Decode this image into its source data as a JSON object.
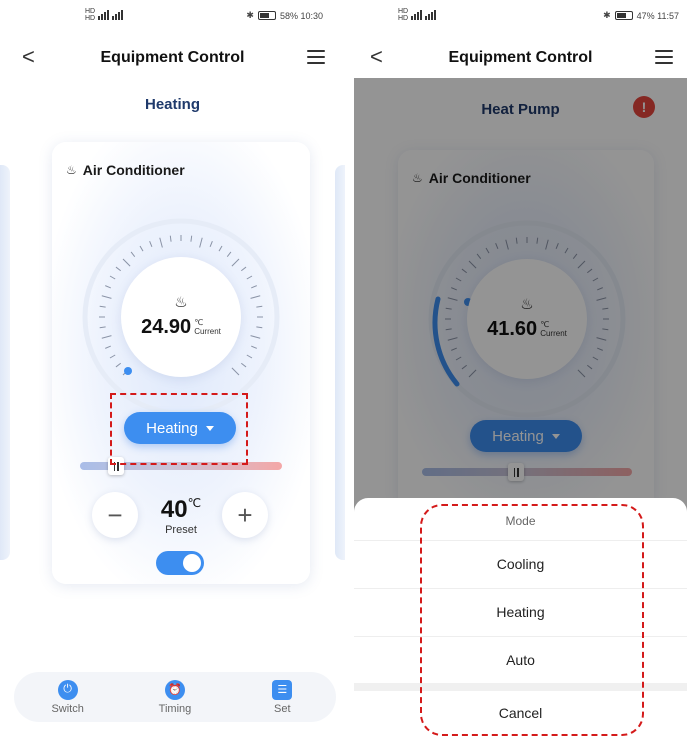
{
  "left": {
    "status": {
      "network": "HD 4G 4G",
      "right_text": "58% 10:30"
    },
    "nav": {
      "title": "Equipment Control",
      "back": "<"
    },
    "section_title": "Heating",
    "card": {
      "device_name": "Air Conditioner",
      "current_temp": "24.90",
      "unit": "℃",
      "current_label": "Current",
      "mode_button": "Heating",
      "preset_temp": "40",
      "preset_unit": "℃",
      "preset_label": "Preset",
      "minus": "−",
      "plus": "+",
      "power_on": true
    },
    "tabs": [
      {
        "label": "Switch",
        "icon": "power-icon"
      },
      {
        "label": "Timing",
        "icon": "alarm-clock-icon"
      },
      {
        "label": "Set",
        "icon": "sliders-icon"
      }
    ]
  },
  "right": {
    "status": {
      "network": "HD 4G 4G",
      "right_text": "47% 11:57"
    },
    "nav": {
      "title": "Equipment Control",
      "back": "<"
    },
    "section_title": "Heat Pump",
    "alert": "!",
    "card": {
      "device_name": "Air Conditioner",
      "current_temp": "41.60",
      "unit": "℃",
      "current_label": "Current",
      "mode_button": "Heating"
    },
    "sheet": {
      "title": "Mode",
      "options": [
        "Cooling",
        "Heating",
        "Auto"
      ],
      "cancel": "Cancel"
    }
  },
  "colors": {
    "accent": "#3d8ef0",
    "highlight_dash": "#d41a1a",
    "title_navy": "#1f3a6b",
    "alert": "#e5453d"
  }
}
